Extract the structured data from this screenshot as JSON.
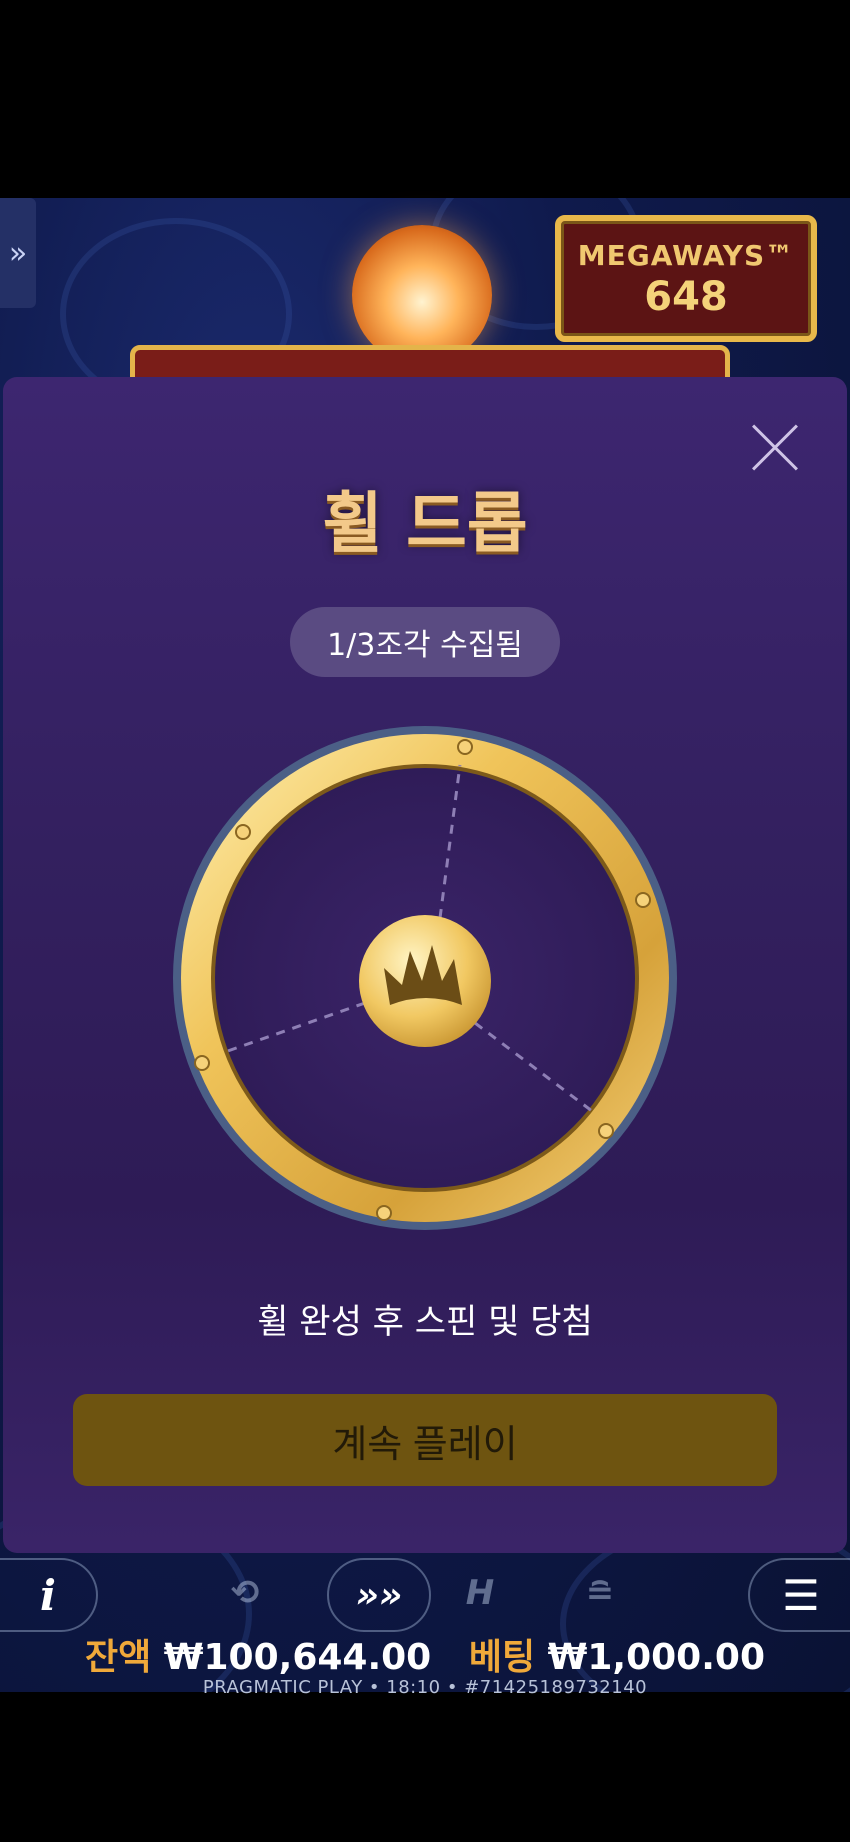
{
  "game": {
    "megaways_label": "MEGAWAYS™",
    "megaways_count": "648",
    "side_tab_icon": "double-chevron-right-icon"
  },
  "modal": {
    "title": "휠 드롭",
    "progress_text": "1/3조각 수집됨",
    "pieces_collected": 1,
    "pieces_total": 3,
    "caption": "휠 완성 후 스핀 및 당첨",
    "continue_label": "계속 플레이",
    "close_icon": "close-icon",
    "center_icon": "crown-icon"
  },
  "controls": {
    "info_label": "i",
    "menu_icon": "hamburger-menu-icon",
    "autoplay_icon": "autoplay-icon",
    "turbo_icon": "turbo-spin-icon",
    "hold_icon": "hold-icon",
    "bet_icon": "coin-stack-icon"
  },
  "status": {
    "balance_label": "잔액",
    "balance_value": "₩100,644.00",
    "bet_label": "베팅",
    "bet_value": "₩1,000.00",
    "footer": "PRAGMATIC PLAY • 18:10 • #71425189732140"
  },
  "colors": {
    "modal_bg": "#33205f",
    "gold": "#e8b84a",
    "continue_button": "#6e5410",
    "balance_label": "#f0a93a"
  }
}
